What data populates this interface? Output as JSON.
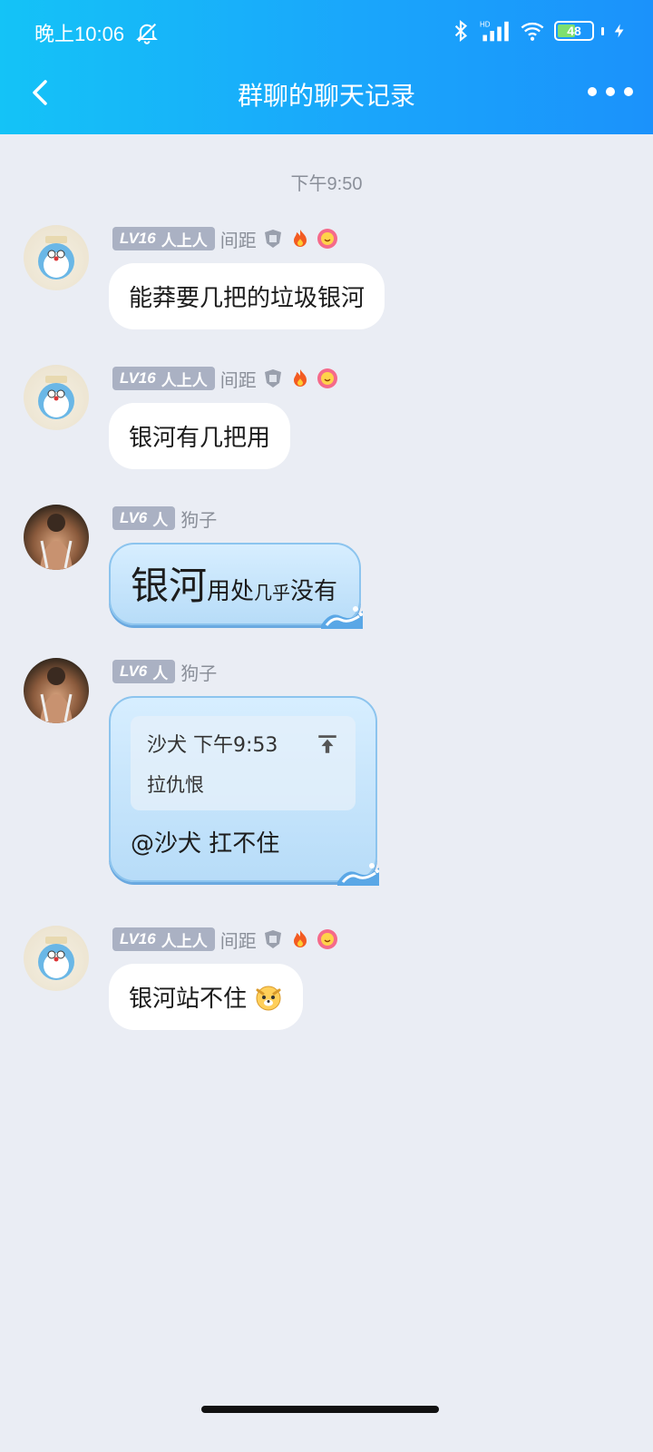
{
  "statusbar": {
    "time": "晚上10:06",
    "battery": "48"
  },
  "nav": {
    "title": "群聊的聊天记录"
  },
  "timestamp": "下午9:50",
  "messages": [
    {
      "level": "LV16",
      "title": "人上人",
      "name": "间距",
      "text": "能莽要几把的垃圾银河"
    },
    {
      "level": "LV16",
      "title": "人上人",
      "name": "间距",
      "text": "银河有几把用"
    },
    {
      "level": "LV6",
      "title": "人",
      "name": "狗子",
      "text_big": "银河",
      "text_mid": "用处",
      "text_small": "几乎",
      "text_end": "没有"
    },
    {
      "level": "LV6",
      "title": "人",
      "name": "狗子",
      "quote": {
        "sender": "沙犬",
        "time": "下午9:53",
        "text": "拉仇恨"
      },
      "text": "@沙犬 扛不住"
    },
    {
      "level": "LV16",
      "title": "人上人",
      "name": "间距",
      "text": "银河站不住"
    }
  ],
  "colors": {
    "header_start": "#14c3f7",
    "header_end": "#1b92fb",
    "background": "#eaedf4",
    "level_badge": "#aab1c3"
  }
}
